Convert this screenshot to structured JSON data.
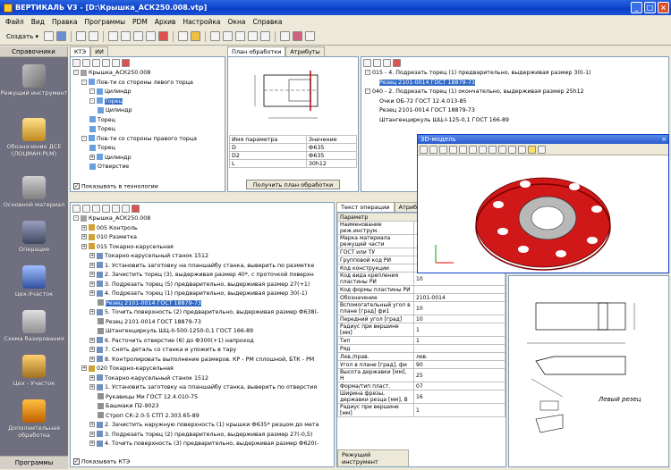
{
  "window": {
    "title": "ВЕРТИКАЛЬ V3 - [D:\\Крышка_АСК250.008.vtp]"
  },
  "menu": [
    "Файл",
    "Вид",
    "Правка",
    "Программы",
    "PDM",
    "Архив",
    "Настройка",
    "Окна",
    "Справка"
  ],
  "toolbar": {
    "create_label": "Создать ▾"
  },
  "sidebar": {
    "header": "Справочники",
    "footer": "Программы",
    "items": [
      {
        "label": "Режущий инструмент"
      },
      {
        "label": "Обозначение ДСЕ (ЛОЦМАН:PLM)"
      },
      {
        "label": "Основной материал"
      },
      {
        "label": "Операция"
      },
      {
        "label": "Цех-Участок"
      },
      {
        "label": "Схема базирования"
      },
      {
        "label": "Цех - Участок"
      },
      {
        "label": "Дополнительная обработка"
      }
    ]
  },
  "kte_panel": {
    "tabs": [
      "КТЭ",
      "ИИ"
    ],
    "tree": [
      {
        "text": "Крышка_АСК250.008",
        "level": 0,
        "pm": "-"
      },
      {
        "text": "Пов-ти со стороны левого торца",
        "level": 1,
        "pm": "-"
      },
      {
        "text": "Цилиндр",
        "level": 2,
        "pm": "-"
      },
      {
        "text": "Торец",
        "level": 2,
        "pm": "-",
        "selected": true
      },
      {
        "text": "Цилиндр",
        "level": 3,
        "pm": ""
      },
      {
        "text": "Торец",
        "level": 2,
        "pm": ""
      },
      {
        "text": "Торец",
        "level": 2,
        "pm": ""
      },
      {
        "text": "Пов-ти со стороны правого торца",
        "level": 1,
        "pm": "-"
      },
      {
        "text": "Торец",
        "level": 2,
        "pm": ""
      },
      {
        "text": "Цилиндр",
        "level": 2,
        "pm": "+"
      },
      {
        "text": "Отверстие",
        "level": 2,
        "pm": ""
      }
    ],
    "checkbox": "Показывать в технологии"
  },
  "plan_panel": {
    "tabs": [
      "План обработки",
      "Атрибуты"
    ],
    "headers": [
      "Имя параметра",
      "Значение"
    ],
    "rows": [
      [
        "D",
        "Ф635"
      ],
      [
        "D2",
        "Ф635"
      ],
      [
        "L",
        "30h12"
      ]
    ],
    "button": "Получить план обработки"
  },
  "ops_panel": {
    "tree": [
      "015 - 4. Подрезать торец (1) предварительно, выдерживая размер 30(-1)",
      "Резец 2101-0014  ГОСТ 18879-73",
      "040 - 2. Подрезать торец (1) окончательно, выдерживая размер 25h12",
      "Очки ОБ-72  ГОСТ 12.4.013-85",
      "Резец 2101-0014  ГОСТ 18879-73",
      "Штангенциркуль ШЦ-І-125-0,1  ГОСТ 166-89"
    ]
  },
  "model3d": {
    "title": "3D-модель"
  },
  "tech_panel": {
    "tree": [
      {
        "t": "Крышка_АСК250.008",
        "l": 0
      },
      {
        "t": "005  Контроль",
        "l": 1
      },
      {
        "t": "010  Разметка",
        "l": 1
      },
      {
        "t": "015  Токарно-карусельная",
        "l": 1
      },
      {
        "t": "Токарно-карусельный станок 1512",
        "l": 2
      },
      {
        "t": "1. Установить заготовку на планшайбу станка, выверить по разметке",
        "l": 2
      },
      {
        "t": "2. Зачистить торец (3), выдерживая размер 40*, с проточкой поверхн",
        "l": 2
      },
      {
        "t": "3. Подрезать торец (5) предварительно, выдерживая размер 27(+1)",
        "l": 2
      },
      {
        "t": "4. Подрезать торец (1) предварительно, выдерживая размер 30(-1)",
        "l": 2
      },
      {
        "t": "Резец 2101-0014  ГОСТ 18879-73",
        "l": 3,
        "sel": true
      },
      {
        "t": "5. Точить поверхность (2) предварительно, выдерживая размер Ф638(-",
        "l": 2
      },
      {
        "t": "Резец 2101-0014  ГОСТ 18879-73",
        "l": 3
      },
      {
        "t": "Штангенциркуль ШЦ-ІІ-500-1250-0,1  ГОСТ 166-89",
        "l": 3
      },
      {
        "t": "6. Расточить отверстие (6) до Ф300(+1) напроход",
        "l": 2
      },
      {
        "t": "7. Снять деталь со станка и уложить в тару",
        "l": 2
      },
      {
        "t": "8. Контролировать выполнение размеров. КР - РМ сплошной, БТК - РМ",
        "l": 2
      },
      {
        "t": "020  Токарно-карусельная",
        "l": 1
      },
      {
        "t": "Токарно-карусельный станок 1512",
        "l": 2
      },
      {
        "t": "1. Установить заготовку на планшайбу станка, выверить по отверстия",
        "l": 2
      },
      {
        "t": "Рукавицы Ми    ГОСТ 12.4.010-75",
        "l": 3
      },
      {
        "t": "Башмаки П2-9023",
        "l": 3
      },
      {
        "t": "Строп СК-2.0-5  СТП 2.303.65-89",
        "l": 3
      },
      {
        "t": "2. Зачистить наружную поверхность (1) крышки Ф635* резцом до мета",
        "l": 2
      },
      {
        "t": "3. Подрезать торец (2) предварительно, выдерживая размер 27(-0,5)",
        "l": 2
      },
      {
        "t": "4. Точить поверхность (3) предварительно, выдерживая размер Ф620(-",
        "l": 2
      }
    ],
    "checkbox": "Показывать КТЭ"
  },
  "attr_panel": {
    "tabs": [
      "Текст операции",
      "Атрибуты"
    ],
    "header": "Параметр",
    "rows": [
      [
        "Наименование реж.инструм.",
        ""
      ],
      [
        "Марка материала режущей части",
        ""
      ],
      [
        "ГОСТ или ТУ",
        ""
      ],
      [
        "Групповой код РИ",
        ""
      ],
      [
        "Код конструкции",
        ""
      ],
      [
        "Код вида крепления пластины РИ",
        "10"
      ],
      [
        "Код формы пластины РИ",
        ""
      ],
      [
        "Обозначение",
        "2101-0014"
      ],
      [
        "Вспомогательный угол в плане [град] фи1",
        "10"
      ],
      [
        "Передний угол [град]",
        "10"
      ],
      [
        "Радиус при вершине [мм]",
        "1"
      ],
      [
        "Тип",
        "1"
      ],
      [
        "Ряд",
        ""
      ],
      [
        "Лев./прав.",
        "лев."
      ],
      [
        "Угол в плане [град], фи",
        "90"
      ],
      [
        "Высота державки [мм], Н",
        "25"
      ],
      [
        "Форма/тип пласт.",
        "07"
      ],
      [
        "Ширина фрезы, державки резца [мм], В",
        "16"
      ],
      [
        "Радиус при вершине [мм]",
        "1"
      ]
    ],
    "bottom_tab": "Режущий инструмент"
  },
  "drawing_labels": {
    "tool_caption": "Левый резец"
  }
}
